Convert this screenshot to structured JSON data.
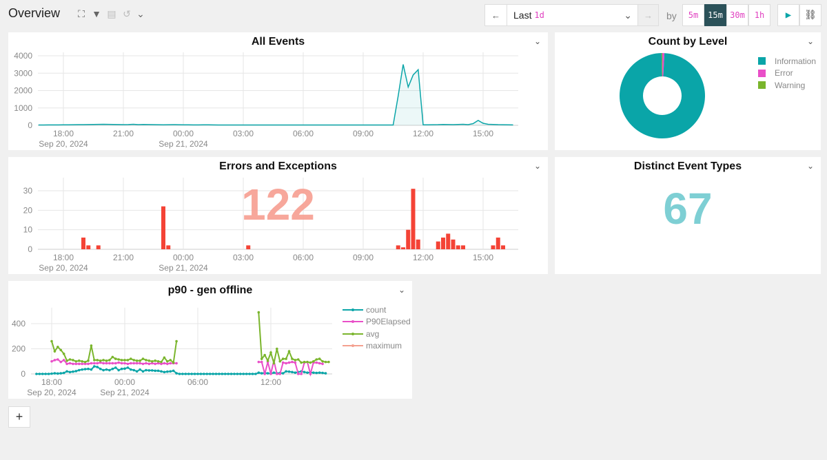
{
  "header": {
    "title": "Overview",
    "icons": [
      "expand-icon",
      "filter-icon",
      "save-icon",
      "undo-icon",
      "chevron-down-icon"
    ]
  },
  "timebar": {
    "range_prefix": "Last",
    "range_value": "1d",
    "by_label": "by",
    "intervals": [
      "5m",
      "15m",
      "30m",
      "1h"
    ],
    "active_interval": "15m",
    "prev_icon": "arrow-left-icon",
    "next_icon": "arrow-right-icon",
    "play_icon": "play-icon",
    "link_icon": "link-icon"
  },
  "colors": {
    "teal": "#0aa5a8",
    "pink": "#e94fc8",
    "green": "#7ab52c",
    "salmon": "#f4a08f",
    "red": "#f44336",
    "active": "#2b5159"
  },
  "add_label": "+",
  "panels": {
    "all_events": {
      "title": "All Events"
    },
    "count_by_level": {
      "title": "Count by Level"
    },
    "errors": {
      "title": "Errors and Exceptions",
      "total": "122"
    },
    "distinct": {
      "title": "Distinct Event Types",
      "value": "67"
    },
    "p90": {
      "title": "p90 - gen offline"
    }
  },
  "chart_data": [
    {
      "id": "all_events",
      "type": "area",
      "title": "All Events",
      "ylim": [
        0,
        4000
      ],
      "y_ticks": [
        "0",
        "1000",
        "2000",
        "3000",
        "4000"
      ],
      "x_ticks": [
        {
          "t": "2024-09-20T18:00",
          "label": "18:00",
          "date": "Sep 20, 2024"
        },
        {
          "t": "2024-09-20T21:00",
          "label": "21:00"
        },
        {
          "t": "2024-09-21T00:00",
          "label": "00:00",
          "date": "Sep 21, 2024"
        },
        {
          "t": "2024-09-21T03:00",
          "label": "03:00"
        },
        {
          "t": "2024-09-21T06:00",
          "label": "06:00"
        },
        {
          "t": "2024-09-21T09:00",
          "label": "09:00"
        },
        {
          "t": "2024-09-21T12:00",
          "label": "12:00"
        },
        {
          "t": "2024-09-21T15:00",
          "label": "15:00"
        }
      ],
      "series": [
        {
          "start": "2024-09-20T16:45",
          "step_minutes": 15,
          "color": "#0aa5a8",
          "values": [
            20,
            20,
            22,
            25,
            25,
            30,
            30,
            35,
            40,
            40,
            45,
            50,
            55,
            60,
            55,
            50,
            45,
            40,
            45,
            60,
            40,
            50,
            45,
            40,
            35,
            30,
            35,
            40,
            35,
            30,
            30,
            25,
            25,
            30,
            30,
            25,
            20,
            20,
            20,
            20,
            20,
            20,
            20,
            20,
            20,
            20,
            20,
            20,
            20,
            20,
            20,
            20,
            20,
            20,
            20,
            20,
            20,
            20,
            20,
            20,
            20,
            20,
            20,
            20,
            20,
            20,
            20,
            20,
            20,
            20,
            20,
            20,
            1700,
            3500,
            2200,
            2900,
            3200,
            30,
            30,
            35,
            40,
            50,
            45,
            40,
            50,
            60,
            40,
            100,
            280,
            120,
            60,
            50,
            40,
            35,
            30,
            25
          ]
        }
      ]
    },
    {
      "id": "count_by_level",
      "type": "pie",
      "donut": true,
      "legend": "right",
      "slices": [
        {
          "name": "Information",
          "value": 98.9,
          "color": "#0aa5a8"
        },
        {
          "name": "Error",
          "value": 0.8,
          "color": "#e94fc8"
        },
        {
          "name": "Warning",
          "value": 0.3,
          "color": "#7ab52c"
        }
      ]
    },
    {
      "id": "errors",
      "type": "bar",
      "title": "Errors and Exceptions",
      "ylim": [
        0,
        35
      ],
      "y_ticks": [
        "0",
        "10",
        "20",
        "30"
      ],
      "color": "#f44336",
      "x_ticks": [
        {
          "t": "2024-09-20T18:00",
          "label": "18:00",
          "date": "Sep 20, 2024"
        },
        {
          "t": "2024-09-20T21:00",
          "label": "21:00"
        },
        {
          "t": "2024-09-21T00:00",
          "label": "00:00",
          "date": "Sep 21, 2024"
        },
        {
          "t": "2024-09-21T03:00",
          "label": "03:00"
        },
        {
          "t": "2024-09-21T06:00",
          "label": "06:00"
        },
        {
          "t": "2024-09-21T09:00",
          "label": "09:00"
        },
        {
          "t": "2024-09-21T12:00",
          "label": "12:00"
        },
        {
          "t": "2024-09-21T15:00",
          "label": "15:00"
        }
      ],
      "bars": [
        [
          "2024-09-20T19:00",
          6
        ],
        [
          "2024-09-20T19:15",
          2
        ],
        [
          "2024-09-20T19:45",
          2
        ],
        [
          "2024-09-20T23:00",
          22
        ],
        [
          "2024-09-20T23:15",
          2
        ],
        [
          "2024-09-21T03:15",
          2
        ],
        [
          "2024-09-21T10:45",
          2
        ],
        [
          "2024-09-21T11:00",
          1
        ],
        [
          "2024-09-21T11:15",
          10
        ],
        [
          "2024-09-21T11:30",
          31
        ],
        [
          "2024-09-21T11:45",
          5
        ],
        [
          "2024-09-21T12:45",
          4
        ],
        [
          "2024-09-21T13:00",
          6
        ],
        [
          "2024-09-21T13:15",
          8
        ],
        [
          "2024-09-21T13:30",
          5
        ],
        [
          "2024-09-21T13:45",
          2
        ],
        [
          "2024-09-21T14:00",
          2
        ],
        [
          "2024-09-21T15:30",
          2
        ],
        [
          "2024-09-21T15:45",
          6
        ],
        [
          "2024-09-21T16:00",
          2
        ]
      ]
    },
    {
      "id": "p90",
      "type": "line",
      "title": "p90 - gen offline",
      "ylim": [
        0,
        500
      ],
      "y_ticks": [
        "0",
        "200",
        "400"
      ],
      "legend": "right",
      "x_ticks": [
        {
          "t": "2024-09-20T18:00",
          "label": "18:00",
          "date": "Sep 20, 2024"
        },
        {
          "t": "2024-09-21T00:00",
          "label": "00:00",
          "date": "Sep 21, 2024"
        },
        {
          "t": "2024-09-21T06:00",
          "label": "06:00"
        },
        {
          "t": "2024-09-21T12:00",
          "label": "12:00"
        }
      ],
      "series": [
        {
          "name": "count",
          "color": "#0aa5a8",
          "start": "2024-09-20T16:45",
          "step_minutes": 15,
          "values": [
            0,
            0,
            0,
            0,
            0,
            2,
            5,
            3,
            5,
            8,
            20,
            15,
            18,
            22,
            30,
            35,
            38,
            40,
            35,
            60,
            55,
            40,
            30,
            35,
            30,
            40,
            50,
            30,
            40,
            42,
            50,
            35,
            30,
            20,
            35,
            20,
            30,
            28,
            28,
            25,
            25,
            20,
            15,
            18,
            20,
            25,
            5,
            0,
            0,
            0,
            0,
            0,
            0,
            0,
            0,
            0,
            0,
            0,
            0,
            0,
            0,
            0,
            0,
            0,
            0,
            0,
            0,
            0,
            0,
            0,
            0,
            0,
            0,
            10,
            5,
            8,
            5,
            3,
            10,
            5,
            8,
            5,
            20,
            18,
            15,
            10,
            15,
            20,
            15,
            10,
            12,
            10,
            8,
            10,
            8,
            5
          ]
        },
        {
          "name": "P90Elapsed",
          "color": "#e94fc8",
          "start": "2024-09-20T18:00",
          "step_minutes": 15,
          "values": [
            100,
            110,
            115,
            95,
            110,
            80,
            85,
            80,
            80,
            80,
            80,
            80,
            80,
            85,
            85,
            85,
            90,
            85,
            85,
            85,
            85,
            85,
            90,
            85,
            85,
            80,
            85,
            85,
            85,
            85,
            80,
            85,
            80,
            85,
            80,
            85,
            80,
            85,
            80,
            85,
            85,
            85,
            null,
            null,
            null,
            null,
            null,
            null,
            null,
            null,
            null,
            null,
            null,
            null,
            null,
            null,
            null,
            null,
            null,
            null,
            null,
            null,
            null,
            null,
            null,
            null,
            null,
            null,
            95,
            95,
            0,
            95,
            0,
            105,
            0,
            0,
            90,
            85,
            90,
            95,
            90,
            0,
            0,
            90,
            95,
            0,
            90,
            90,
            85,
            80
          ]
        },
        {
          "name": "avg",
          "color": "#7ab52c",
          "start": "2024-09-20T18:00",
          "step_minutes": 15,
          "values": [
            260,
            180,
            215,
            190,
            160,
            105,
            115,
            110,
            100,
            105,
            100,
            95,
            105,
            225,
            110,
            110,
            105,
            110,
            105,
            110,
            135,
            120,
            115,
            110,
            110,
            110,
            120,
            110,
            105,
            105,
            120,
            110,
            105,
            100,
            105,
            100,
            95,
            130,
            100,
            110,
            90,
            260,
            null,
            null,
            null,
            null,
            null,
            null,
            null,
            null,
            null,
            null,
            null,
            null,
            null,
            null,
            null,
            null,
            null,
            null,
            null,
            null,
            null,
            null,
            null,
            null,
            null,
            null,
            490,
            120,
            150,
            105,
            170,
            85,
            200,
            100,
            120,
            120,
            180,
            120,
            110,
            115,
            90,
            95,
            95,
            90,
            100,
            115,
            120,
            100,
            95,
            95
          ]
        },
        {
          "name": "maximum",
          "color": "#f4a08f",
          "values": []
        }
      ]
    }
  ]
}
